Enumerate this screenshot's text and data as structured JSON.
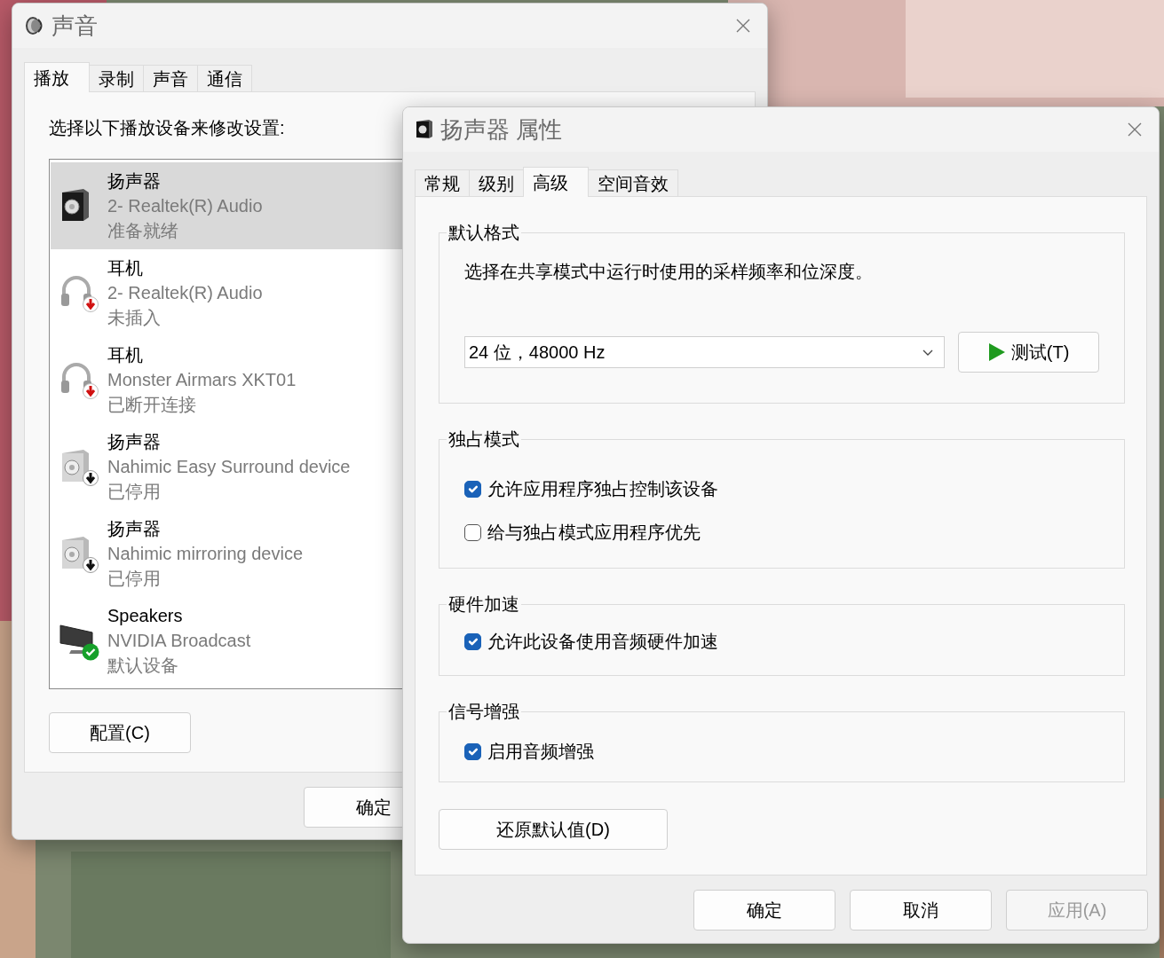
{
  "sound_window": {
    "title": "声音",
    "tabs": [
      {
        "label": "播放",
        "selected": true
      },
      {
        "label": "录制",
        "selected": false
      },
      {
        "label": "声音",
        "selected": false
      },
      {
        "label": "通信",
        "selected": false
      }
    ],
    "instruction": "选择以下播放设备来修改设置:",
    "devices": [
      {
        "name": "扬声器",
        "description": "2- Realtek(R) Audio",
        "status": "准备就绪",
        "kind": "speaker",
        "selected": true
      },
      {
        "name": "耳机",
        "description": "2- Realtek(R) Audio",
        "status": "未插入",
        "kind": "headphones",
        "selected": false
      },
      {
        "name": "耳机",
        "description": "Monster Airmars XKT01",
        "status": "已断开连接",
        "kind": "headphones",
        "selected": false
      },
      {
        "name": "扬声器",
        "description": "Nahimic Easy Surround device",
        "status": "已停用",
        "kind": "disabledspeaker",
        "selected": false
      },
      {
        "name": "扬声器",
        "description": "Nahimic mirroring device",
        "status": "已停用",
        "kind": "disabledspeaker",
        "selected": false
      },
      {
        "name": "Speakers",
        "description": "NVIDIA Broadcast",
        "status": "默认设备",
        "kind": "defaultmonitor",
        "selected": false
      }
    ],
    "configure_button": "配置(C)",
    "ok_button": "确定"
  },
  "properties_window": {
    "title": "扬声器 属性",
    "tabs": [
      {
        "label": "常规",
        "selected": false
      },
      {
        "label": "级别",
        "selected": false
      },
      {
        "label": "高级",
        "selected": true
      },
      {
        "label": "空间音效",
        "selected": false
      }
    ],
    "groups": [
      {
        "kind": "format",
        "title": "默认格式",
        "description": "选择在共享模式中运行时使用的采样频率和位深度。",
        "format_value": "24 位，48000 Hz",
        "test_button": "测试(T)"
      },
      {
        "kind": "checkboxes",
        "title": "独占模式",
        "options": [
          {
            "label": "允许应用程序独占控制该设备",
            "checked": true
          },
          {
            "label": "给与独占模式应用程序优先",
            "checked": false
          }
        ]
      },
      {
        "kind": "checkboxes",
        "title": "硬件加速",
        "options": [
          {
            "label": "允许此设备使用音频硬件加速",
            "checked": true
          }
        ]
      },
      {
        "kind": "checkboxes",
        "title": "信号增强",
        "options": [
          {
            "label": "启用音频增强",
            "checked": true
          }
        ]
      }
    ],
    "restore_button": "还原默认值(D)",
    "buttons": [
      {
        "label": "确定",
        "disabled": false
      },
      {
        "label": "取消",
        "disabled": false
      },
      {
        "label": "应用(A)",
        "disabled": true
      }
    ]
  }
}
